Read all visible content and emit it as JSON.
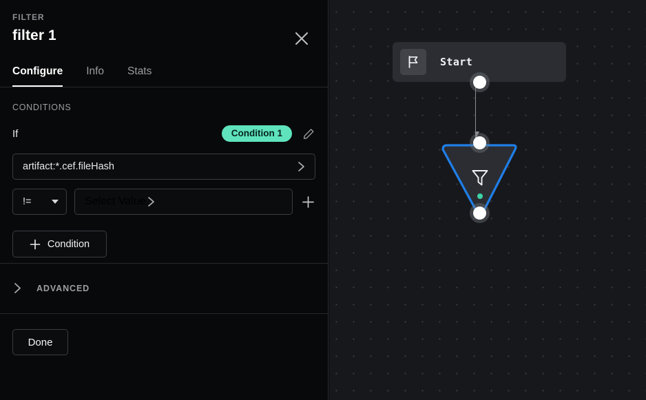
{
  "panel": {
    "kicker": "FILTER",
    "title": "filter 1",
    "close_icon": "close-icon",
    "tabs": [
      {
        "label": "Configure",
        "active": true
      },
      {
        "label": "Info",
        "active": false
      },
      {
        "label": "Stats",
        "active": false
      }
    ],
    "conditions": {
      "section_label": "CONDITIONS",
      "if_label": "If",
      "condition_pill": "Condition 1",
      "pill_color": "#5fe3bd",
      "edit_icon": "pencil-icon",
      "field_value": "artifact:*.cef.fileHash",
      "field_chevron_icon": "chevron-right-icon",
      "operator": "!=",
      "operator_caret_icon": "chevron-down-icon",
      "value_placeholder": "Select Value",
      "value_chevron_icon": "chevron-right-icon",
      "add_param_icon": "plus-icon",
      "add_condition_label": "Condition",
      "add_condition_icon": "plus-icon"
    },
    "advanced": {
      "label": "ADVANCED",
      "expand_icon": "chevron-right-icon"
    },
    "done_label": "Done"
  },
  "canvas": {
    "background": "#17181c",
    "dot_color": "#3a3c41",
    "nodes": [
      {
        "id": "start",
        "label": "Start",
        "icon": "flag-icon",
        "type": "start",
        "color": "#2b2d33"
      },
      {
        "id": "filter",
        "label": "",
        "icon": "funnel-icon",
        "type": "filter",
        "selected": true,
        "border_color": "#1f7fe8",
        "status_dot_color": "#3ed2a7"
      }
    ],
    "edges": [
      {
        "from": "start",
        "to": "filter",
        "color": "#8b8f95"
      }
    ]
  }
}
